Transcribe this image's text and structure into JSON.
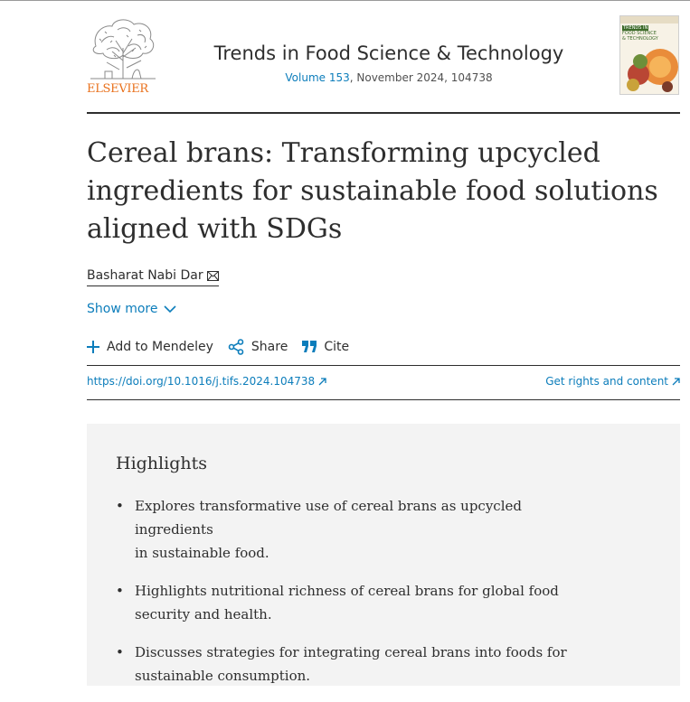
{
  "header": {
    "publisher": "ELSEVIER",
    "journal_title": "Trends in Food Science & Technology",
    "volume_link": "Volume 153",
    "issue_info": ", November 2024, 104738",
    "cover_text": [
      "TRENDS IN",
      "FOOD SCIENCE",
      "& TECHNOLOGY"
    ]
  },
  "article": {
    "title": "Cereal brans: Transforming upcycled ingredients for sustainable food solutions aligned with SDGs",
    "author": "Basharat Nabi Dar",
    "show_more": "Show more"
  },
  "actions": {
    "mendeley": "Add to Mendeley",
    "share": "Share",
    "cite": "Cite"
  },
  "links": {
    "doi": "https://doi.org/10.1016/j.tifs.2024.104738",
    "rights": "Get rights and content"
  },
  "highlights": {
    "heading": "Highlights",
    "items": [
      {
        "bullet": "•",
        "line1": "Explores transformative use of cereal brans as upcycled ingredients",
        "line2": "in sustainable food."
      },
      {
        "bullet": "•",
        "line1": "Highlights nutritional richness of cereal brans for global food",
        "line2": "security and health."
      },
      {
        "bullet": "•",
        "line1": "Discusses strategies for integrating cereal brans into foods for",
        "line2": "sustainable consumption."
      }
    ]
  },
  "colors": {
    "link": "#0c7dbb",
    "elsevier_orange": "#e9711c",
    "text": "#2e2e2e",
    "highlights_bg": "#f3f3f3"
  },
  "icons": [
    "elsevier-tree-logo",
    "journal-cover",
    "mail-icon",
    "chevron-down-icon",
    "plus-icon",
    "share-icon",
    "cite-quote-icon",
    "external-link-icon"
  ]
}
